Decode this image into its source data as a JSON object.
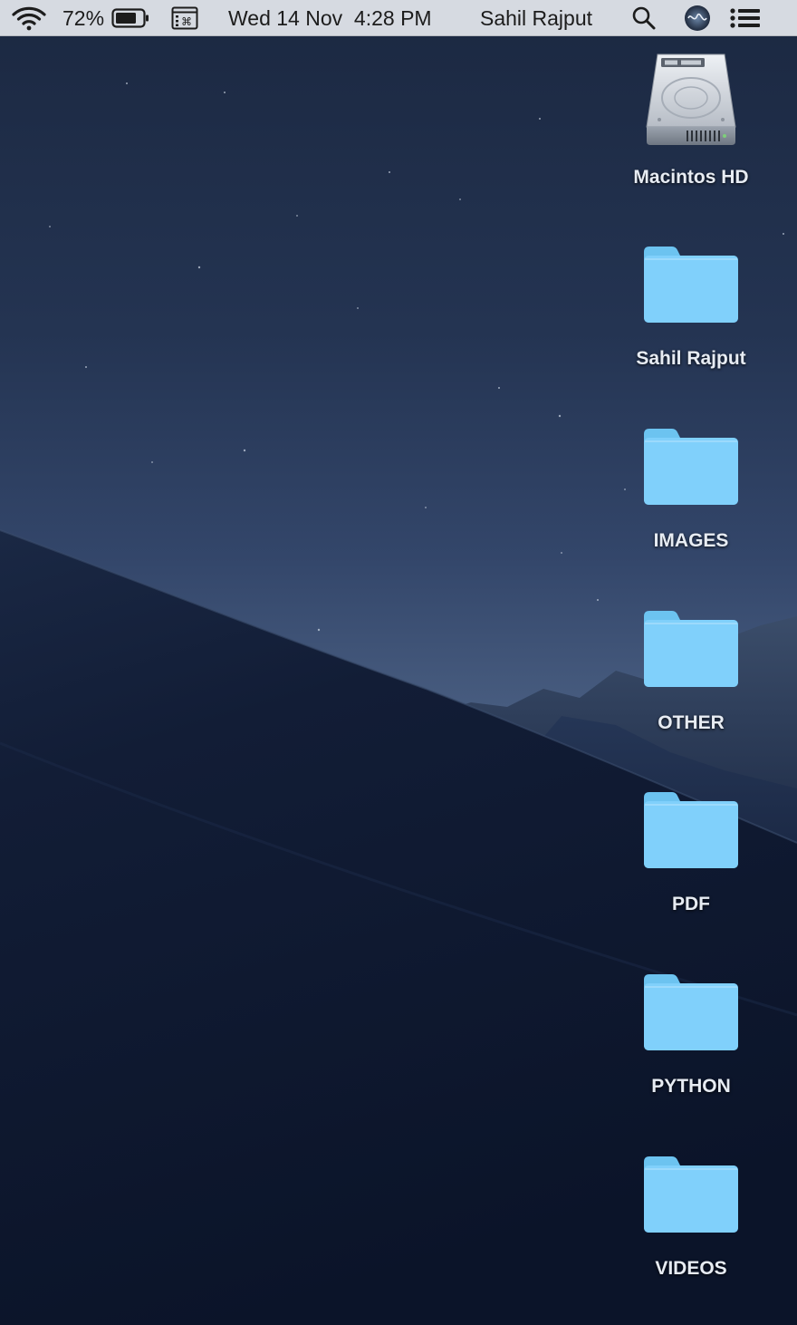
{
  "menubar": {
    "battery_percent": "72%",
    "datetime": "Wed 14 Nov  4:28 PM",
    "user_name": "Sahil Rajput",
    "icons": [
      "wifi-icon",
      "battery-icon",
      "keyboard-viewer-icon",
      "spotlight-search-icon",
      "siri-icon",
      "notification-center-icon"
    ]
  },
  "desktop": {
    "items": [
      {
        "label": "Macintos HD",
        "icon": "hard-drive-icon"
      },
      {
        "label": "Sahil Rajput",
        "icon": "folder-icon"
      },
      {
        "label": "IMAGES",
        "icon": "folder-icon"
      },
      {
        "label": "OTHER",
        "icon": "folder-icon"
      },
      {
        "label": "PDF",
        "icon": "folder-icon"
      },
      {
        "label": "PYTHON",
        "icon": "folder-icon"
      },
      {
        "label": "VIDEOS",
        "icon": "folder-icon"
      }
    ]
  },
  "colors": {
    "menubar_bg": "#dee2e8",
    "folder_blue": "#7fd0fb",
    "wallpaper_sky": "#2a3b58",
    "wallpaper_dune": "#0f1a30"
  }
}
